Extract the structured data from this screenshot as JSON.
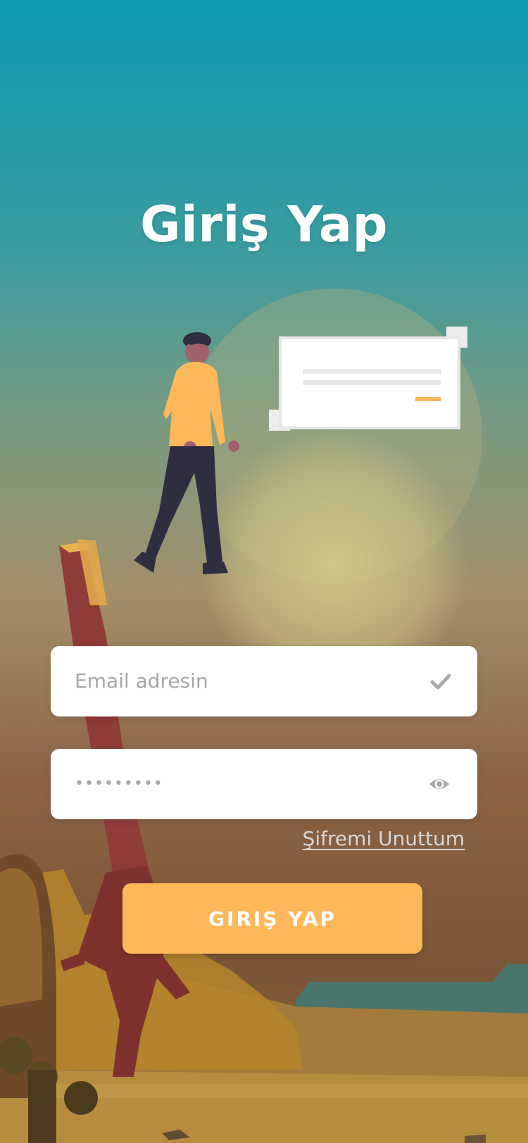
{
  "title": "Giriş Yap",
  "form": {
    "email": {
      "placeholder": "Email adresin",
      "icon": "check-icon"
    },
    "password": {
      "value": "•••••••••",
      "icon": "eye-icon"
    },
    "forgot_password": "Şifremi Unuttum",
    "submit_label": "GIRIŞ YAP"
  },
  "colors": {
    "accent": "#fdb85a",
    "sky_top": "#0c9ab2",
    "sky_mid": "#5c978c",
    "ground": "#8a5e3c",
    "title": "#ffffff"
  }
}
